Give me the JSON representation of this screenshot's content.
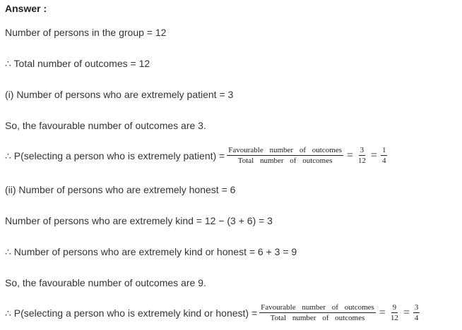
{
  "heading": "Answer :",
  "lines": {
    "l1": "Number of persons in the group = 12",
    "l2": "∴ Total number of outcomes = 12",
    "l3": "(i) Number of persons who are extremely patient = 3",
    "l4": "So, the favourable number of outcomes are 3.",
    "l5_prefix": "∴ P(selecting a person who is extremely patient) =",
    "l6": "(ii) Number of persons who are extremely honest = 6",
    "l7": "Number of persons who are extremely kind = 12 − (3 + 6) = 3",
    "l8": "∴ Number of persons who are extremely kind or honest = 6 + 3 = 9",
    "l9": "So, the favourable number of outcomes are 9.",
    "l10_prefix": "∴ P(selecting a person who is extremely kind or honest) ="
  },
  "fractions": {
    "formula_num": "Favourable number of outcomes",
    "formula_den": "Total number of outcomes",
    "eq": "=",
    "p1_num": "3",
    "p1_den": "12",
    "p1s_num": "1",
    "p1s_den": "4",
    "p2_num": "9",
    "p2_den": "12",
    "p2s_num": "3",
    "p2s_den": "4"
  }
}
